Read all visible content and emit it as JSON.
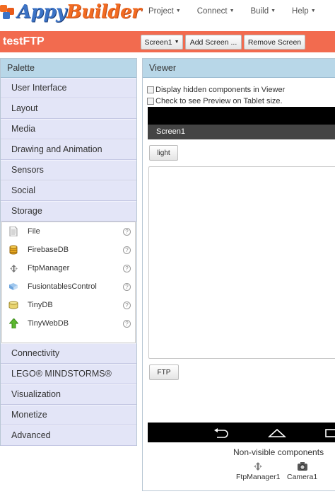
{
  "brand": {
    "name_part1": "Appy",
    "name_part2": "Builder"
  },
  "nav": {
    "menus": [
      {
        "label": "Project"
      },
      {
        "label": "Connect"
      },
      {
        "label": "Build"
      },
      {
        "label": "Help"
      }
    ],
    "caret": "▼"
  },
  "project": {
    "title": "testFTP",
    "screen_select": "Screen1",
    "add_screen": "Add Screen ...",
    "remove_screen": "Remove Screen"
  },
  "palette": {
    "title": "Palette",
    "categories_top": [
      "User Interface",
      "Layout",
      "Media",
      "Drawing and Animation",
      "Sensors",
      "Social",
      "Storage"
    ],
    "storage_items": [
      {
        "label": "File",
        "icon": "file-icon"
      },
      {
        "label": "FirebaseDB",
        "icon": "database-icon"
      },
      {
        "label": "FtpManager",
        "icon": "ftp-icon"
      },
      {
        "label": "FusiontablesControl",
        "icon": "fusiontables-icon"
      },
      {
        "label": "TinyDB",
        "icon": "tinydb-icon"
      },
      {
        "label": "TinyWebDB",
        "icon": "upload-arrow-icon"
      }
    ],
    "help_glyph": "?",
    "categories_bottom": [
      "Connectivity",
      "LEGO® MINDSTORMS®",
      "Visualization",
      "Monetize",
      "Advanced"
    ]
  },
  "viewer": {
    "title": "Viewer",
    "display_hidden_label": "Display hidden components in Viewer",
    "tablet_preview_label": "Check to see Preview on Tablet size.",
    "screen_title": "Screen1",
    "button_light": "light",
    "button_ftp": "FTP",
    "nonvisible_title": "Non-visible components",
    "nonvisible": [
      {
        "label": "FtpManager1",
        "icon": "ftp-icon"
      },
      {
        "label": "Camera1",
        "icon": "camera-icon"
      }
    ]
  },
  "colors": {
    "brand_orange": "#f26b21",
    "brand_blue": "#3b73c6",
    "project_bar": "#f26b4f",
    "panel_header": "#b8d7e8",
    "category_bg": "#e3e5f7"
  }
}
